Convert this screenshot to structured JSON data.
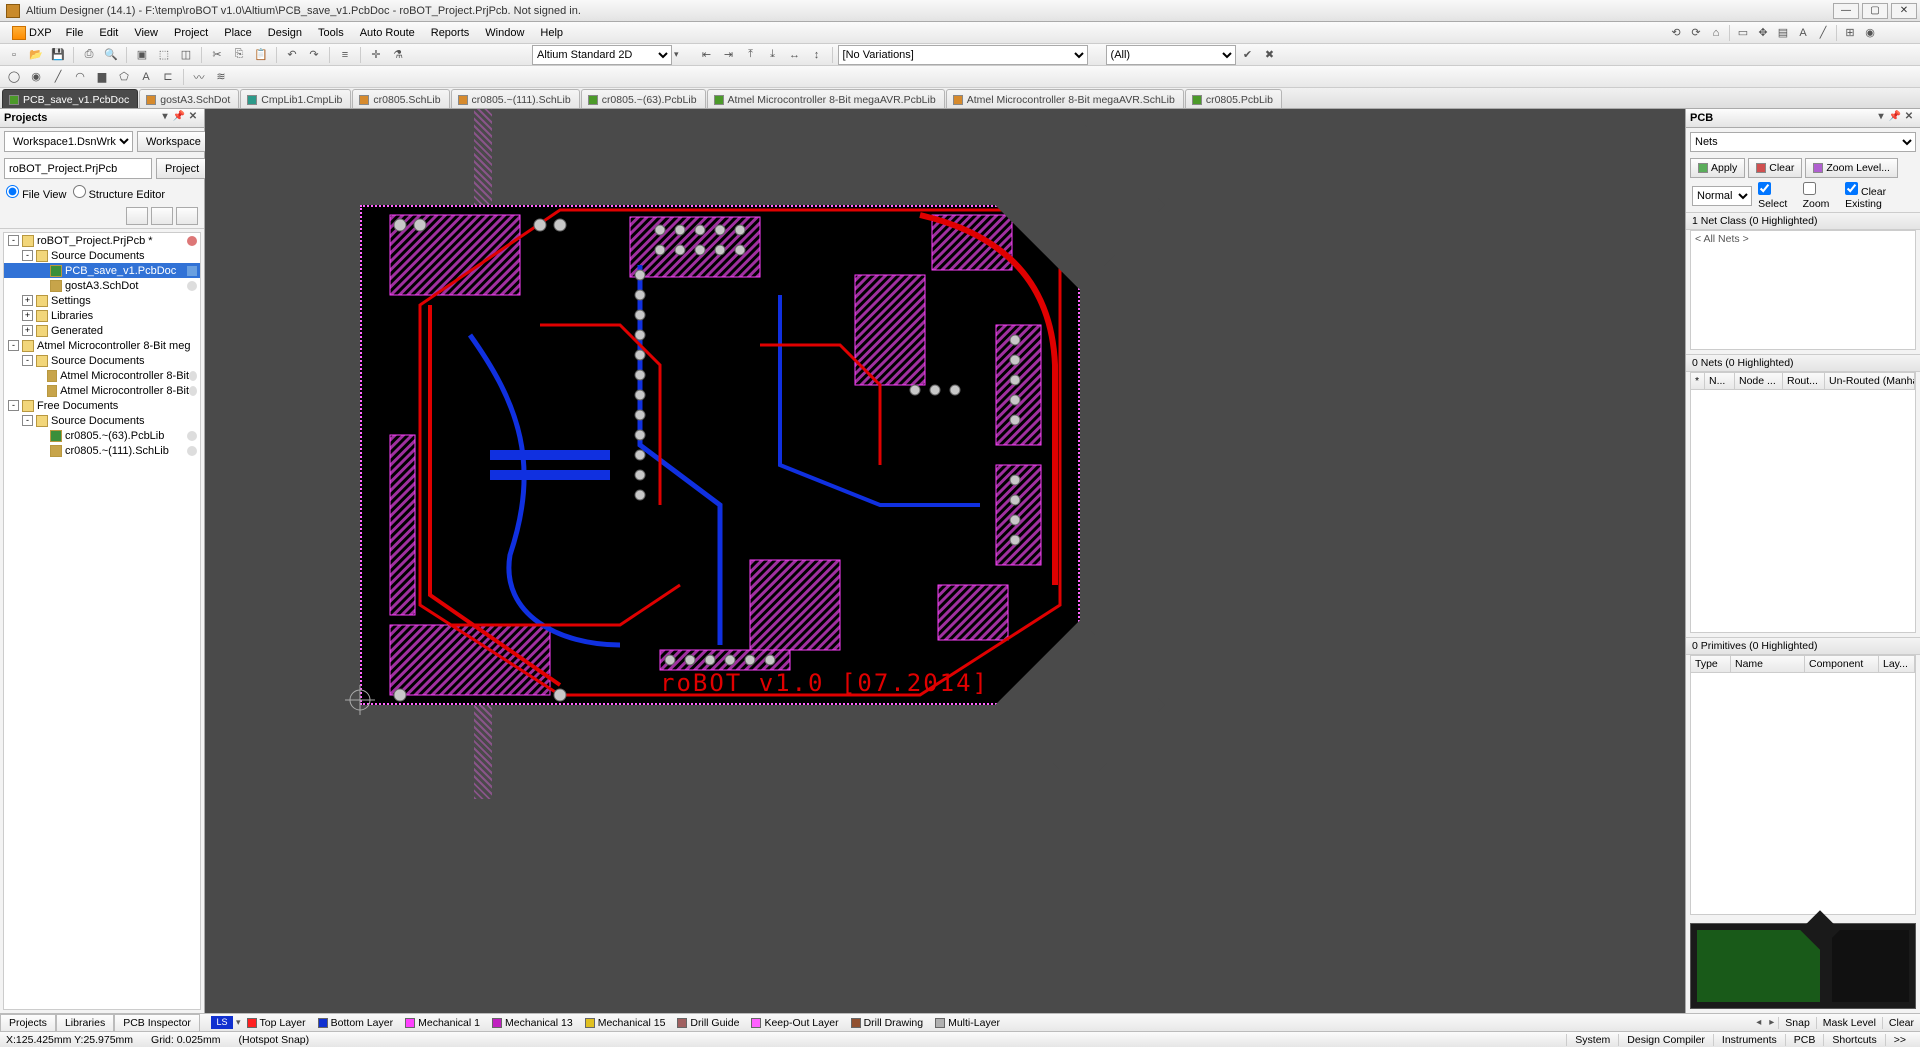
{
  "title": "Altium Designer (14.1) - F:\\temp\\roBOT v1.0\\Altium\\PCB_save_v1.PcbDoc - roBOT_Project.PrjPcb. Not signed in.",
  "menu": {
    "dxp": "DXP",
    "file": "File",
    "edit": "Edit",
    "view": "View",
    "project": "Project",
    "place": "Place",
    "design": "Design",
    "tools": "Tools",
    "autoroute": "Auto Route",
    "reports": "Reports",
    "window": "Window",
    "help": "Help"
  },
  "toolbar2": {
    "viewMode": "Altium Standard 2D",
    "variations": "[No Variations]",
    "filterAll": "(All)"
  },
  "docTabs": [
    {
      "label": "PCB_save_v1.PcbDoc",
      "icon": "green",
      "active": true
    },
    {
      "label": "gostA3.SchDot",
      "icon": "orange"
    },
    {
      "label": "CmpLib1.CmpLib",
      "icon": "teal"
    },
    {
      "label": "cr0805.SchLib",
      "icon": "orange"
    },
    {
      "label": "cr0805.~(111).SchLib",
      "icon": "orange"
    },
    {
      "label": "cr0805.~(63).PcbLib",
      "icon": "green"
    },
    {
      "label": "Atmel Microcontroller 8-Bit megaAVR.PcbLib",
      "icon": "green"
    },
    {
      "label": "Atmel Microcontroller 8-Bit megaAVR.SchLib",
      "icon": "orange"
    },
    {
      "label": "cr0805.PcbLib",
      "icon": "green"
    }
  ],
  "projects": {
    "panelTitle": "Projects",
    "workspaceCombo": "Workspace1.DsnWrk",
    "workspaceBtn": "Workspace",
    "projectCombo": "roBOT_Project.PrjPcb",
    "projectBtn": "Project",
    "radioFileView": "File View",
    "radioStructure": "Structure Editor",
    "tree": [
      {
        "lv": 0,
        "exp": "-",
        "icon": "folder",
        "label": "roBOT_Project.PrjPcb *",
        "mark": "red"
      },
      {
        "lv": 1,
        "exp": "-",
        "icon": "folder",
        "label": "Source Documents"
      },
      {
        "lv": 2,
        "icon": "pcb",
        "label": "PCB_save_v1.PcbDoc",
        "sel": true,
        "mark": "doc"
      },
      {
        "lv": 2,
        "icon": "sch",
        "label": "gostA3.SchDot",
        "mark": "none2"
      },
      {
        "lv": 1,
        "exp": "+",
        "icon": "folder",
        "label": "Settings"
      },
      {
        "lv": 1,
        "exp": "+",
        "icon": "folder",
        "label": "Libraries"
      },
      {
        "lv": 1,
        "exp": "+",
        "icon": "folder",
        "label": "Generated"
      },
      {
        "lv": 0,
        "exp": "-",
        "icon": "folder",
        "label": "Atmel Microcontroller 8-Bit meg"
      },
      {
        "lv": 1,
        "exp": "-",
        "icon": "folder",
        "label": "Source Documents"
      },
      {
        "lv": 2,
        "icon": "sch",
        "label": "Atmel Microcontroller 8-Bit",
        "mark": "none2"
      },
      {
        "lv": 2,
        "icon": "sch",
        "label": "Atmel Microcontroller 8-Bit",
        "mark": "none2"
      },
      {
        "lv": 0,
        "exp": "-",
        "icon": "folder",
        "label": "Free Documents"
      },
      {
        "lv": 1,
        "exp": "-",
        "icon": "folder",
        "label": "Source Documents"
      },
      {
        "lv": 2,
        "icon": "pcb",
        "label": "cr0805.~(63).PcbLib",
        "mark": "none2"
      },
      {
        "lv": 2,
        "icon": "sch",
        "label": "cr0805.~(111).SchLib",
        "mark": "none2"
      }
    ],
    "auxTabs": [
      "Projects",
      "Libraries",
      "PCB Inspector"
    ]
  },
  "board": {
    "silk": "roBOT_v1.0  [07.2014]"
  },
  "pcbPanel": {
    "title": "PCB",
    "mode": "Nets",
    "apply": "Apply",
    "clear": "Clear",
    "zoom": "Zoom Level...",
    "normal": "Normal",
    "cbSelect": "Select",
    "cbZoom": "Zoom",
    "cbClearExisting": "Clear Existing",
    "netClassHdr": "1 Net Class (0 Highlighted)",
    "allNets": "< All Nets >",
    "netsHdr": "0 Nets (0 Highlighted)",
    "netCols": {
      "star": "*",
      "name": "N...",
      "node": "Node ...",
      "routed": "Rout...",
      "unrouted": "Un-Routed (Manhatta..."
    },
    "primsHdr": "0 Primitives (0 Highlighted)",
    "primCols": {
      "type": "Type",
      "name": "Name",
      "component": "Component",
      "layer": "Lay..."
    }
  },
  "layerBar": {
    "ls": "LS",
    "layers": [
      {
        "color": "#ff2020",
        "label": "Top Layer"
      },
      {
        "color": "#1030d0",
        "label": "Bottom Layer"
      },
      {
        "color": "#ff40ff",
        "label": "Mechanical 1"
      },
      {
        "color": "#c020c0",
        "label": "Mechanical 13"
      },
      {
        "color": "#e0c020",
        "label": "Mechanical 15"
      },
      {
        "color": "#a06060",
        "label": "Drill Guide"
      },
      {
        "color": "#ff60ff",
        "label": "Keep-Out Layer"
      },
      {
        "color": "#905030",
        "label": "Drill Drawing"
      },
      {
        "color": "#b0b0b0",
        "label": "Multi-Layer"
      }
    ],
    "snap": "Snap",
    "mask": "Mask Level",
    "clear": "Clear"
  },
  "status": {
    "coord": "X:125.425mm Y:25.975mm",
    "grid": "Grid: 0.025mm",
    "hotspot": "(Hotspot Snap)",
    "tabs": [
      "System",
      "Design Compiler",
      "Instruments",
      "PCB",
      "Shortcuts",
      ">>"
    ]
  }
}
